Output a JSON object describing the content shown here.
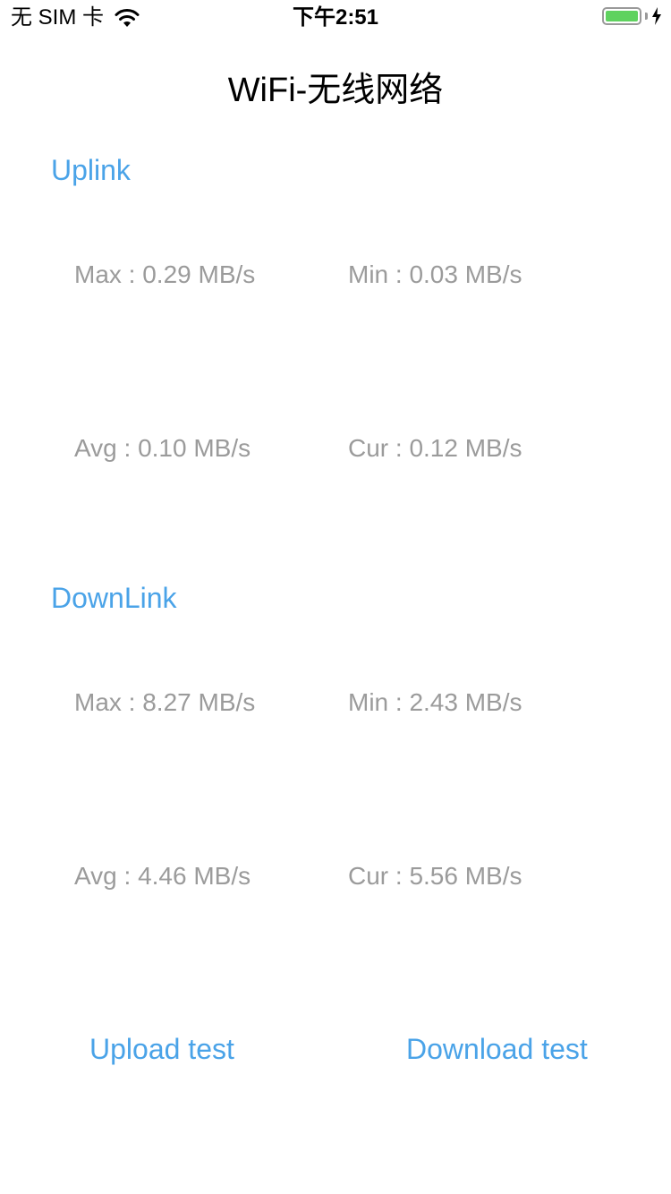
{
  "status_bar": {
    "carrier": "无 SIM 卡",
    "time": "下午2:51",
    "battery_level": 1.0,
    "battery_color": "#5fd25f"
  },
  "title": "WiFi-无线网络",
  "accent_color": "#4aa3e8",
  "uplink": {
    "heading": "Uplink",
    "max": "Max : 0.29 MB/s",
    "min": "Min : 0.03 MB/s",
    "avg": "Avg : 0.10 MB/s",
    "cur": "Cur : 0.12 MB/s"
  },
  "downlink": {
    "heading": "DownLink",
    "max": "Max : 8.27 MB/s",
    "min": "Min : 2.43 MB/s",
    "avg": "Avg : 4.46 MB/s",
    "cur": "Cur : 5.56 MB/s"
  },
  "buttons": {
    "upload": "Upload test",
    "download": "Download test"
  },
  "icons": {
    "wifi": "wifi-icon",
    "battery": "battery-icon",
    "charging": "bolt-icon"
  }
}
